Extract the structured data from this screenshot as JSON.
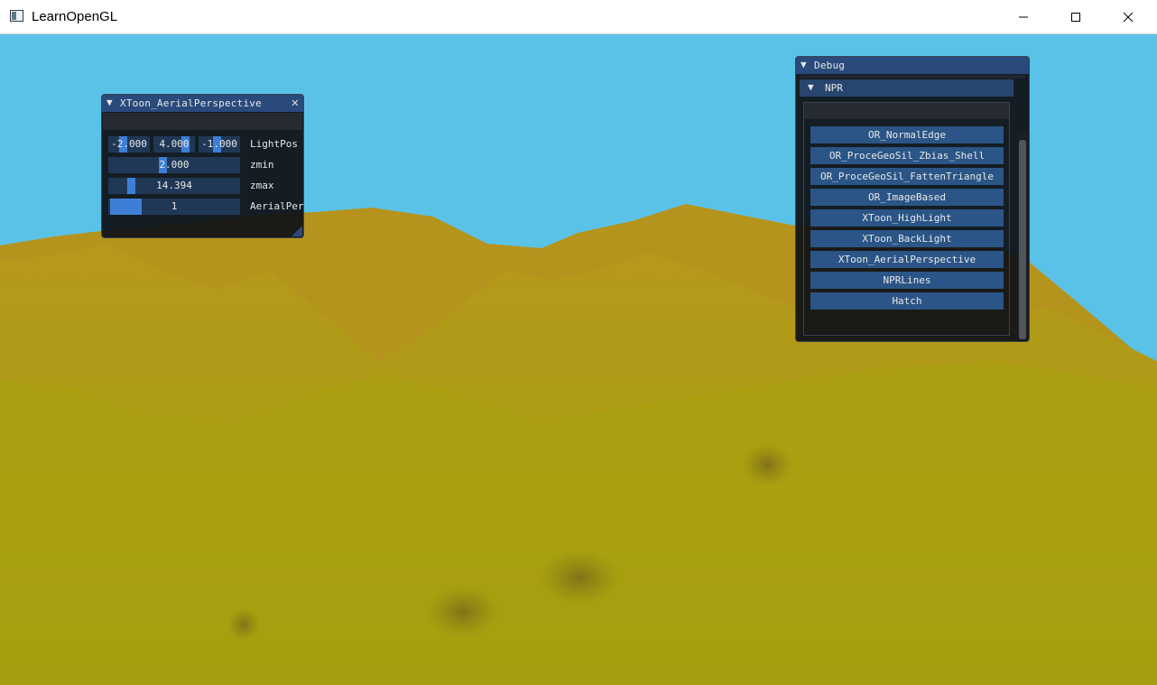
{
  "window": {
    "title": "LearnOpenGL",
    "controls": {
      "minimize": "minimize",
      "maximize": "maximize",
      "close": "close"
    }
  },
  "colors": {
    "sky": "#5bc2e7",
    "terrain_far": "#b99a1c",
    "terrain_near": "#a6a10b",
    "imgui_title": "#2a4a7c",
    "imgui_frame": "#203856",
    "imgui_button": "#2a5586",
    "imgui_grab": "#3d7fd6"
  },
  "xtoon_panel": {
    "title": "XToon_AerialPerspective",
    "collapse_icon": "▼",
    "close_icon": "✕",
    "light_pos": {
      "x": "-2.000",
      "y": "4.000",
      "z": "-1.000",
      "label": "LightPos"
    },
    "zmin": {
      "value": "2.000",
      "label": "zmin"
    },
    "zmax": {
      "value": "14.394",
      "label": "zmax"
    },
    "aerial": {
      "value": "1",
      "label": "AerialPer"
    }
  },
  "debug_panel": {
    "title": "Debug",
    "collapse_icon": "▼",
    "npr_header": {
      "label": "NPR",
      "icon": "▼"
    },
    "buttons": [
      "OR_NormalEdge",
      "OR_ProceGeoSil_Zbias_Shell",
      "OR_ProceGeoSil_FattenTriangle",
      "OR_ImageBased",
      "XToon_HighLight",
      "XToon_BackLight",
      "XToon_AerialPerspective",
      "NPRLines",
      "Hatch"
    ]
  }
}
